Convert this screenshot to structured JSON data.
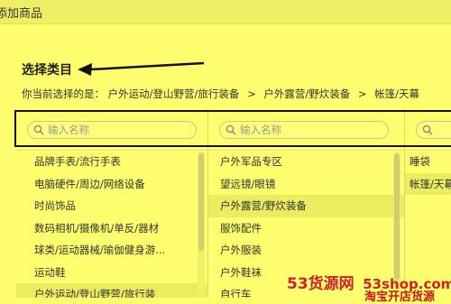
{
  "window": {
    "title": "添加商品"
  },
  "section": {
    "title": "选择类目"
  },
  "current_path": {
    "prefix": "你当前选择的是：",
    "segments": [
      "户外运动/登山野营/旅行装备",
      "户外露营/野炊装备",
      "帐篷/天幕"
    ],
    "separator": ">"
  },
  "search": {
    "placeholder": "输入名称"
  },
  "columns": [
    {
      "items": [
        {
          "label": "品牌手表/流行手表",
          "selected": false
        },
        {
          "label": "电脑硬件/周边/网络设备",
          "selected": false
        },
        {
          "label": "时尚饰品",
          "selected": false
        },
        {
          "label": "数码相机/摄像机/单反/器材",
          "selected": false
        },
        {
          "label": "球类/运动器械/瑜伽健身游...",
          "selected": false
        },
        {
          "label": "运动鞋",
          "selected": false
        },
        {
          "label": "户外运动/登山野营/旅行装",
          "selected": true
        }
      ]
    },
    {
      "items": [
        {
          "label": "户外军品专区",
          "selected": false
        },
        {
          "label": "望远镜/眼镜",
          "selected": false
        },
        {
          "label": "户外露营/野炊装备",
          "selected": true
        },
        {
          "label": "服饰配件",
          "selected": false
        },
        {
          "label": "户外服装",
          "selected": false
        },
        {
          "label": "户外鞋袜",
          "selected": false
        },
        {
          "label": "自行车",
          "selected": false
        }
      ]
    },
    {
      "items": [
        {
          "label": "睡袋",
          "selected": false
        },
        {
          "label": "帐篷/天幕",
          "selected": true
        }
      ]
    }
  ],
  "watermark": {
    "brand": "53货源网",
    "url": "53shop.com",
    "slogan": "淘宝开店货源"
  },
  "colors": {
    "background": "#fefe6e",
    "annotation": "#111111",
    "watermark": "#d0202a"
  }
}
